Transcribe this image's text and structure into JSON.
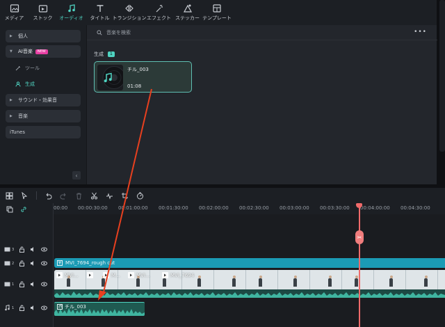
{
  "toolbar": {
    "items": [
      {
        "label": "メディア",
        "icon": "media-icon"
      },
      {
        "label": "ストック",
        "icon": "stock-icon"
      },
      {
        "label": "オーディオ",
        "icon": "music-note-icon",
        "active": true
      },
      {
        "label": "タイトル",
        "icon": "title-text-icon"
      },
      {
        "label": "トランジション",
        "icon": "transition-icon"
      },
      {
        "label": "エフェクト",
        "icon": "effect-sparkle-icon"
      },
      {
        "label": "ステッカー",
        "icon": "sticker-icon"
      },
      {
        "label": "テンプレート",
        "icon": "template-icon"
      }
    ]
  },
  "sidebar": {
    "personal": "個人",
    "ai_music": "AI音楽",
    "new_badge": "NEW",
    "tool": "ツール",
    "generate": "生成",
    "sound_effects": "サウンド・効果音",
    "music": "音楽",
    "itunes": "iTunes"
  },
  "browser": {
    "search_placeholder": "音楽を検索",
    "section_label": "生成",
    "section_count": "1",
    "card": {
      "name": "チル_003",
      "duration": "01:08"
    }
  },
  "ruler": {
    "ticks": [
      "00:00",
      "00:00:30:00",
      "00:01:00:00",
      "00:01:30:00",
      "00:02:00:00",
      "00:02:30:00",
      "00:03:00:00",
      "00:03:30:00",
      "00:04:00:00",
      "00:04:30:00"
    ]
  },
  "tracks": {
    "t3": "3",
    "t2": "2",
    "t1": "1",
    "a1": "1"
  },
  "clips": {
    "title_clip": "MVI_7694_rough cut",
    "video_segments": [
      "MVI...",
      "M...",
      "MVI...",
      "MVI_7694"
    ],
    "audio_clip": "チル_003"
  },
  "colors": {
    "accent": "#4fd3c1",
    "playhead": "#f06a6a",
    "title_track": "#1b9bb5",
    "annotation_arrow": "#e8401f"
  }
}
